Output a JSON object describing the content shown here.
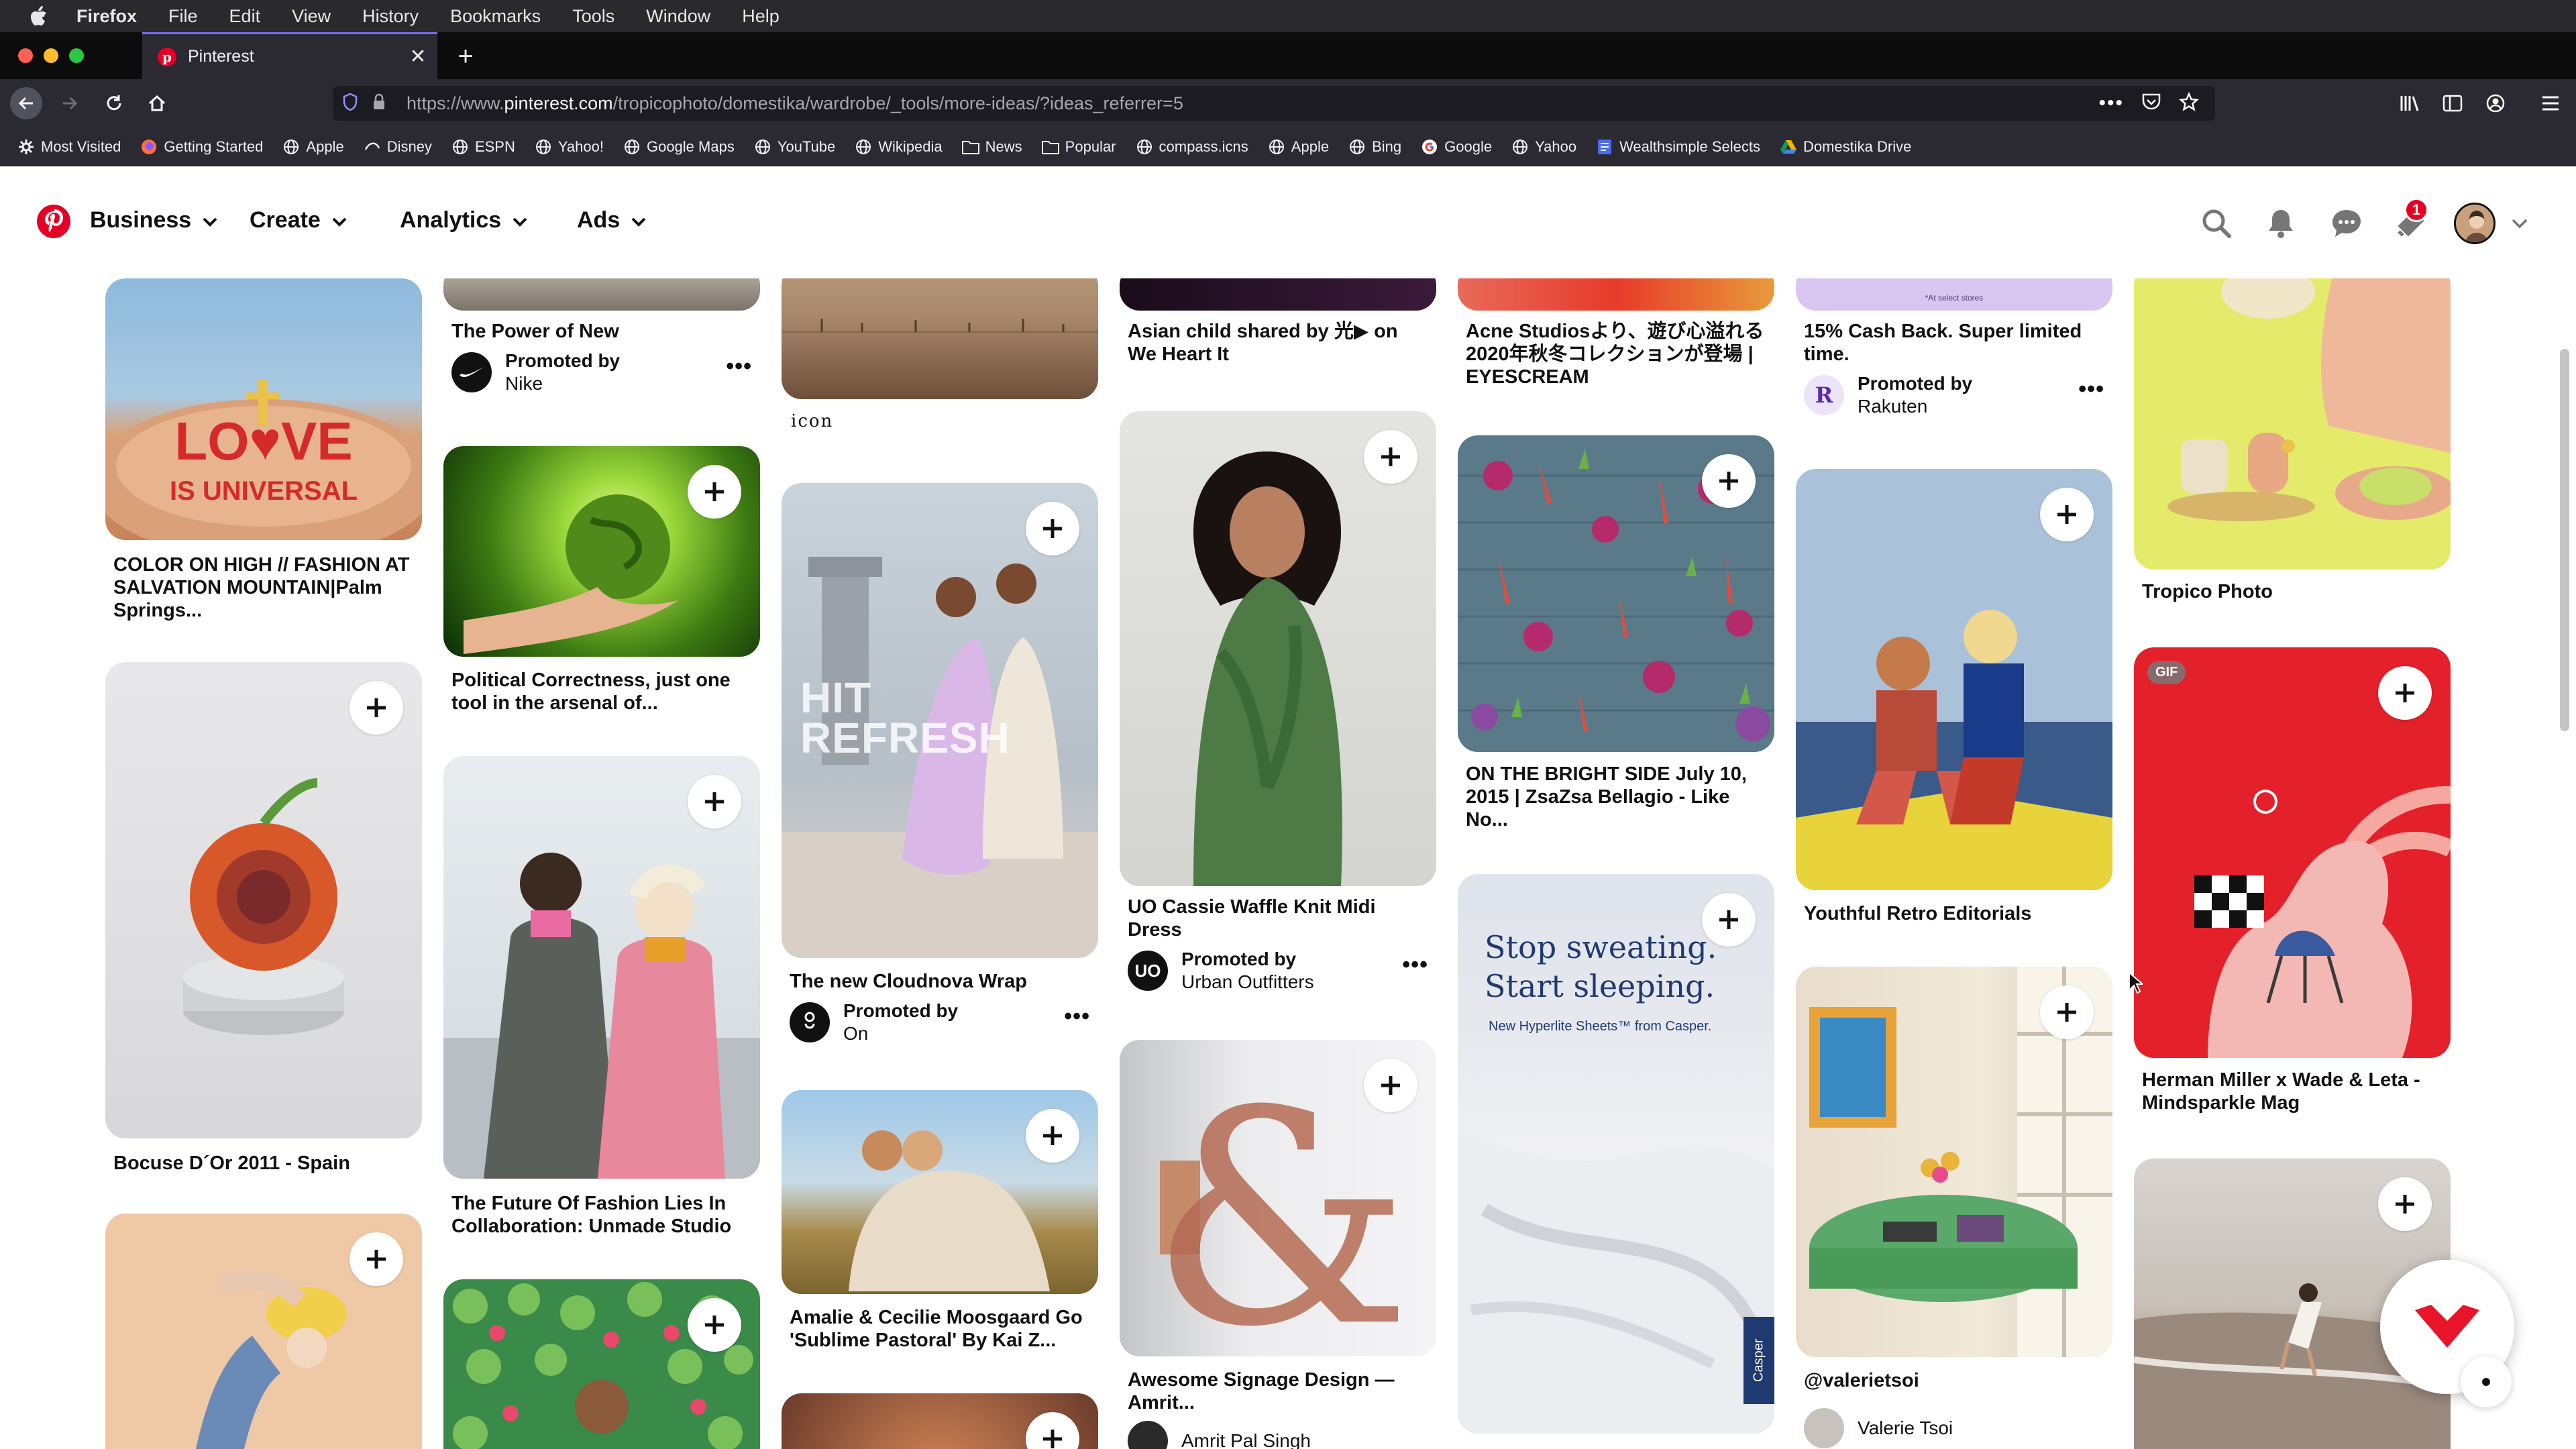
{
  "menubar": {
    "app": "Firefox",
    "items": [
      "File",
      "Edit",
      "View",
      "History",
      "Bookmarks",
      "Tools",
      "Window",
      "Help"
    ]
  },
  "tab": {
    "title": "Pinterest"
  },
  "urlbar": {
    "prefix": "https://www.",
    "domain": "pinterest.com",
    "path": "/tropicophoto/domestika/wardrobe/_tools/more-ideas/?ideas_referrer=5"
  },
  "bookmarks": [
    {
      "label": "Most Visited",
      "icon": "gear-icon"
    },
    {
      "label": "Getting Started",
      "icon": "firefox-icon"
    },
    {
      "label": "Apple",
      "icon": "globe-icon"
    },
    {
      "label": "Disney",
      "icon": "disney-icon"
    },
    {
      "label": "ESPN",
      "icon": "globe-icon"
    },
    {
      "label": "Yahoo!",
      "icon": "globe-icon"
    },
    {
      "label": "Google Maps",
      "icon": "globe-icon"
    },
    {
      "label": "YouTube",
      "icon": "globe-icon"
    },
    {
      "label": "Wikipedia",
      "icon": "globe-icon"
    },
    {
      "label": "News",
      "icon": "folder-icon"
    },
    {
      "label": "Popular",
      "icon": "folder-icon"
    },
    {
      "label": "compass.icns",
      "icon": "globe-icon"
    },
    {
      "label": "Apple",
      "icon": "globe-icon"
    },
    {
      "label": "Bing",
      "icon": "globe-icon"
    },
    {
      "label": "Google",
      "icon": "google-icon"
    },
    {
      "label": "Yahoo",
      "icon": "globe-icon"
    },
    {
      "label": "Wealthsimple Selects",
      "icon": "doc-icon"
    },
    {
      "label": "Domestika Drive",
      "icon": "drive-icon"
    }
  ],
  "header": {
    "menus": [
      "Business",
      "Create",
      "Analytics",
      "Ads"
    ],
    "notification_count": "1"
  },
  "pins": {
    "col1": [
      {
        "title": "COLOR ON HIGH // FASHION AT SALVATION MOUNTAIN|Palm Springs..."
      },
      {
        "title": "Bocuse D´Or 2011 - Spain"
      },
      {
        "title": ""
      }
    ],
    "col2": [
      {
        "title": "The Power of New",
        "promoted_label": "Promoted by",
        "advertiser": "Nike"
      },
      {
        "title": "Political Correctness, just one tool in the arsenal of..."
      },
      {
        "title": "The Future Of Fashion Lies In Collaboration: Unmade Studio"
      },
      {
        "title": ""
      }
    ],
    "col3": [
      {
        "caption": "icon"
      },
      {
        "title": "The new Cloudnova Wrap",
        "promoted_label": "Promoted by",
        "advertiser": "On",
        "overlay": "HIT REFRESH"
      },
      {
        "title": "Amalie & Cecilie Moosgaard Go 'Sublime Pastoral' By Kai Z..."
      },
      {
        "title": ""
      }
    ],
    "col4": [
      {
        "title": "Asian child shared by 光▶ on We Heart It"
      },
      {
        "title": "UO Cassie Waffle Knit Midi Dress",
        "promoted_label": "Promoted by",
        "advertiser": "Urban Outfitters",
        "advertiser_initials": "UO"
      },
      {
        "title": "Awesome Signage Design — Amrit...",
        "author": "Amrit Pal Singh"
      }
    ],
    "col5": [
      {
        "title": "Acne Studiosより、遊び心溢れる2020年秋冬コレクションが登場 | EYESCREAM"
      },
      {
        "title": "ON THE BRIGHT SIDE July 10, 2015 | ZsaZsa Bellagio - Like No..."
      },
      {
        "title": "",
        "ad_headline_1": "Stop sweating.",
        "ad_headline_2": "Start sleeping.",
        "ad_sub": "New Hyperlite Sheets™ from Casper.",
        "ad_brand": "Casper"
      }
    ],
    "col6": [
      {
        "title": "15% Cash Back. Super limited time.",
        "promoted_label": "Promoted by",
        "advertiser": "Rakuten",
        "advertiser_initials": "R",
        "img_note": "*At select stores"
      },
      {
        "title": "Youthful Retro Editorials"
      },
      {
        "title": "@valerietsoi",
        "author": "Valerie Tsoi"
      }
    ],
    "col7": [
      {
        "title": "Tropico Photo"
      },
      {
        "title": "Herman Miller x Wade & Leta - Mindsparkle Mag",
        "badge": "GIF"
      },
      {
        "title": ""
      }
    ]
  },
  "colors": {
    "pinterest_red": "#e60023",
    "firefox_chrome": "#2b2a33",
    "mac_menubar": "#2a2a2c"
  }
}
